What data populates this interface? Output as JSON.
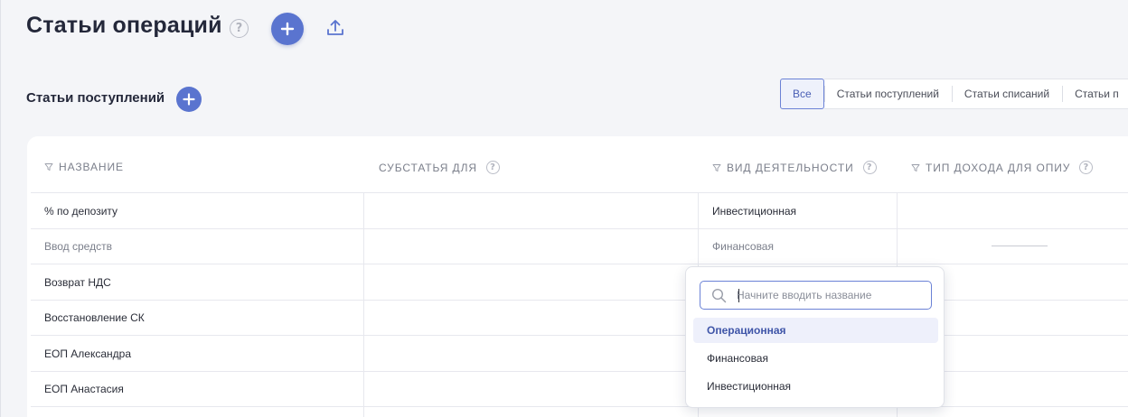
{
  "header": {
    "title": "Статьи операций",
    "help_icon": "question-icon",
    "add_icon": "plus-icon",
    "export_icon": "upload-icon"
  },
  "section": {
    "title": "Статьи поступлений",
    "add_icon": "plus-icon"
  },
  "filter_tabs": [
    {
      "label": "Все",
      "active": true
    },
    {
      "label": "Статьи поступлений",
      "active": false
    },
    {
      "label": "Статьи списаний",
      "active": false
    },
    {
      "label": "Статьи п",
      "active": false
    }
  ],
  "table": {
    "columns": [
      {
        "label": "НАЗВАНИЕ",
        "filter": true,
        "help": false
      },
      {
        "label": "СУБСТАТЬЯ ДЛЯ",
        "filter": false,
        "help": true
      },
      {
        "label": "ВИД ДЕЯТЕЛЬНОСТИ",
        "filter": true,
        "help": true
      },
      {
        "label": "ТИП ДОХОДА ДЛЯ ОПИУ",
        "filter": true,
        "help": true
      }
    ],
    "rows": [
      {
        "name": "% по депозиту",
        "activity": "Инвестиционная",
        "muted": false
      },
      {
        "name": "Ввод средств",
        "activity": "Финансовая",
        "muted": true
      },
      {
        "name": "Возврат НДС",
        "activity": "",
        "muted": false
      },
      {
        "name": "Восстановление СК",
        "activity": "",
        "muted": false
      },
      {
        "name": "ЕОП Александра",
        "activity": "",
        "muted": false
      },
      {
        "name": "ЕОП Анастасия",
        "activity": "",
        "muted": false
      }
    ]
  },
  "dropdown": {
    "search_placeholder": "Начните вводить название",
    "search_icon": "search-icon",
    "options": [
      {
        "label": "Операционная",
        "selected": true
      },
      {
        "label": "Финансовая",
        "selected": false
      },
      {
        "label": "Инвестиционная",
        "selected": false
      }
    ]
  },
  "colors": {
    "accent": "#5a74cf",
    "background": "#f4f5f8",
    "card": "#ffffff",
    "selected_option_bg": "#eef0fb"
  }
}
